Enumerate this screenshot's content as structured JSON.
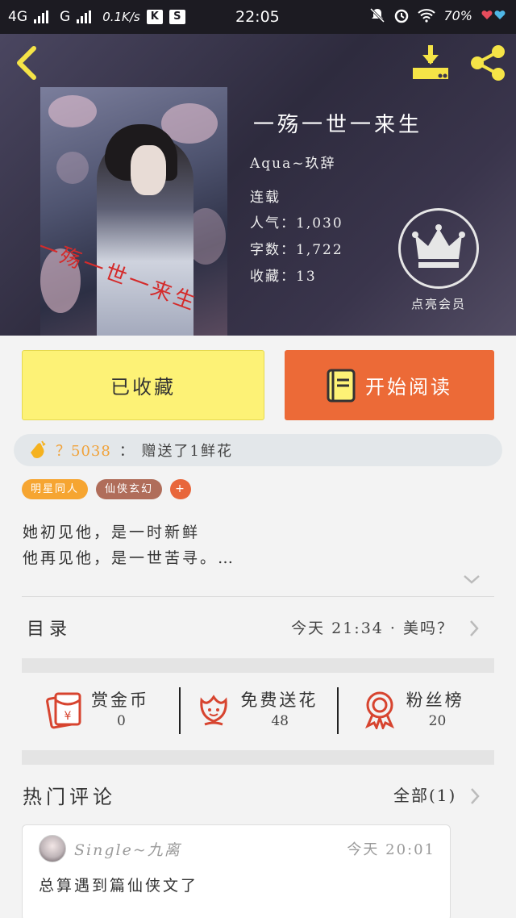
{
  "status_bar": {
    "network_1": "4G",
    "network_2": "G",
    "speed": "0.1K/s",
    "badge_1": "K",
    "badge_2": "S",
    "time": "22:05",
    "battery": "70%"
  },
  "book": {
    "title": "一殇一世一来生",
    "cover_title": "一殇一世一来生",
    "author": "Aqua~玖辞",
    "status": "连载",
    "popularity": "人气：1,030",
    "words": "字数：1,722",
    "favorites": "收藏：13",
    "vip_label": "点亮会员"
  },
  "actions": {
    "collect_label": "已收藏",
    "read_label": "开始阅读"
  },
  "gift": {
    "user": "？5038",
    "text": "：  赠送了1鲜花"
  },
  "tags": [
    "明星同人",
    "仙侠玄幻"
  ],
  "tag_add": "+",
  "synopsis": {
    "line1": "她初见他，是一时新鲜",
    "line2": "他再见他，是一世苦寻。…"
  },
  "catalog": {
    "label": "目录",
    "latest": "今天 21:34 · 美吗？"
  },
  "stats": [
    {
      "name": "赏金币",
      "value": "0",
      "icon": "red-envelope-icon"
    },
    {
      "name": "免费送花",
      "value": "48",
      "icon": "flower-icon"
    },
    {
      "name": "粉丝榜",
      "value": "20",
      "icon": "ribbon-badge-icon"
    }
  ],
  "comments": {
    "title": "热门评论",
    "all_label": "全部(1)",
    "items": [
      {
        "user": "Single~九离",
        "time": "今天 20:01",
        "text": "总算遇到篇仙侠文了"
      }
    ]
  },
  "colors": {
    "accent_orange": "#ec6a37",
    "collect_yellow": "#fdf276",
    "icon_red": "#d7442f",
    "header_yellow_icons": "#f5e447"
  }
}
